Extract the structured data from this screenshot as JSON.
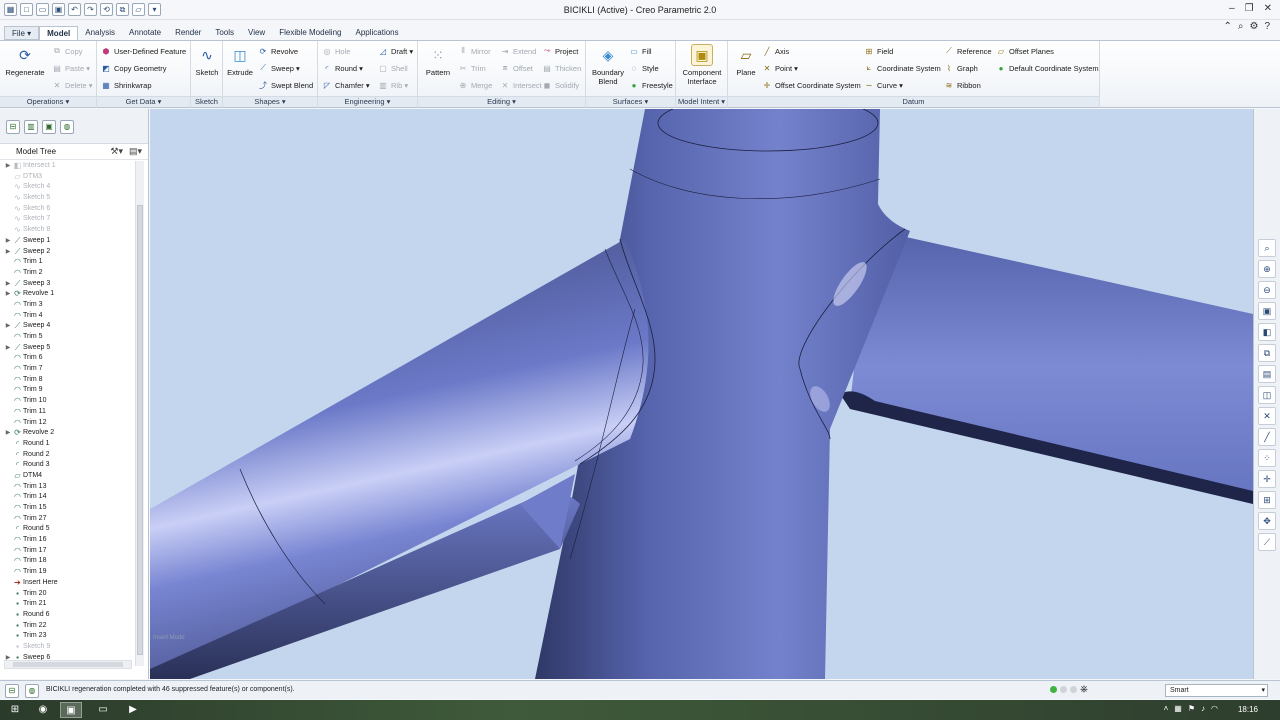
{
  "window": {
    "title": "BICIKLI (Active) - Creo Parametric 2.0"
  },
  "tabs": [
    {
      "label": "File ▾"
    },
    {
      "label": "Model"
    },
    {
      "label": "Analysis"
    },
    {
      "label": "Annotate"
    },
    {
      "label": "Render"
    },
    {
      "label": "Tools"
    },
    {
      "label": "View"
    },
    {
      "label": "Flexible Modeling"
    },
    {
      "label": "Applications"
    }
  ],
  "ribbon": {
    "operations": {
      "label": "Operations ▾",
      "regenerate": "Regenerate",
      "copy": "Copy",
      "paste": "Paste ▾",
      "delete": "Delete ▾"
    },
    "getdata": {
      "label": "Get Data ▾",
      "udf": "User-Defined Feature",
      "copy_geometry": "Copy Geometry",
      "shrinkwrap": "Shrinkwrap"
    },
    "sketch": {
      "label": "Sketch",
      "button": "Sketch"
    },
    "shapes": {
      "label": "Shapes ▾",
      "extrude": "Extrude",
      "revolve": "Revolve",
      "sweep": "Sweep ▾",
      "swept_blend": "Swept Blend"
    },
    "engineering": {
      "label": "Engineering ▾",
      "hole": "Hole",
      "round": "Round ▾",
      "chamfer": "Chamfer ▾",
      "draft": "Draft ▾",
      "shell": "Shell",
      "rib": "Rib ▾"
    },
    "editing": {
      "label": "Editing ▾",
      "pattern": "Pattern",
      "mirror": "Mirror",
      "trim": "Trim",
      "merge": "Merge",
      "extend": "Extend",
      "offset": "Offset",
      "intersect": "Intersect",
      "project": "Project",
      "thicken": "Thicken",
      "solidify": "Solidify"
    },
    "surfaces": {
      "label": "Surfaces ▾",
      "boundary_blend": "Boundary Blend",
      "fill": "Fill",
      "style": "Style",
      "freestyle": "Freestyle"
    },
    "modelintent": {
      "label": "Model Intent ▾",
      "component_interface": "Component Interface"
    },
    "datum": {
      "label": "Datum",
      "plane": "Plane",
      "axis": "Axis",
      "point": "Point ▾",
      "offset_csys": "Offset Coordinate System",
      "field": "Field",
      "coordinate_system": "Coordinate System",
      "curve": "Curve ▾",
      "reference": "Reference",
      "graph": "Graph",
      "ribbon": "Ribbon",
      "offset_planes": "Offset Planes",
      "default_csys": "Default Coordinate System"
    }
  },
  "model_tree": {
    "title": "Model Tree",
    "items": [
      {
        "label": "Intersect 1",
        "expand": "▶",
        "icon": "◧",
        "sup": true
      },
      {
        "label": "DTM3",
        "expand": "",
        "icon": "▱",
        "sup": true
      },
      {
        "label": "Sketch 4",
        "expand": "",
        "icon": "∿",
        "sup": true
      },
      {
        "label": "Sketch 5",
        "expand": "",
        "icon": "∿",
        "sup": true
      },
      {
        "label": "Sketch 6",
        "expand": "",
        "icon": "∿",
        "sup": true
      },
      {
        "label": "Sketch 7",
        "expand": "",
        "icon": "∿",
        "sup": true
      },
      {
        "label": "Sketch 8",
        "expand": "",
        "icon": "∿",
        "sup": true
      },
      {
        "label": "Sweep 1",
        "expand": "▶",
        "icon": "⟋",
        "sup": false
      },
      {
        "label": "Sweep 2",
        "expand": "▶",
        "icon": "⟋",
        "sup": false
      },
      {
        "label": "Trim 1",
        "expand": "",
        "icon": "◠",
        "sup": false
      },
      {
        "label": "Trim 2",
        "expand": "",
        "icon": "◠",
        "sup": false
      },
      {
        "label": "Sweep 3",
        "expand": "▶",
        "icon": "⟋",
        "sup": false
      },
      {
        "label": "Revolve 1",
        "expand": "▶",
        "icon": "⟳",
        "sup": false
      },
      {
        "label": "Trim 3",
        "expand": "",
        "icon": "◠",
        "sup": false
      },
      {
        "label": "Trim 4",
        "expand": "",
        "icon": "◠",
        "sup": false
      },
      {
        "label": "Sweep 4",
        "expand": "▶",
        "icon": "⟋",
        "sup": false
      },
      {
        "label": "Trim 5",
        "expand": "",
        "icon": "◠",
        "sup": false
      },
      {
        "label": "Sweep 5",
        "expand": "▶",
        "icon": "⟋",
        "sup": false
      },
      {
        "label": "Trim 6",
        "expand": "",
        "icon": "◠",
        "sup": false
      },
      {
        "label": "Trim 7",
        "expand": "",
        "icon": "◠",
        "sup": false
      },
      {
        "label": "Trim 8",
        "expand": "",
        "icon": "◠",
        "sup": false
      },
      {
        "label": "Trim 9",
        "expand": "",
        "icon": "◠",
        "sup": false
      },
      {
        "label": "Trim 10",
        "expand": "",
        "icon": "◠",
        "sup": false
      },
      {
        "label": "Trim 11",
        "expand": "",
        "icon": "◠",
        "sup": false
      },
      {
        "label": "Trim 12",
        "expand": "",
        "icon": "◠",
        "sup": false
      },
      {
        "label": "Revolve 2",
        "expand": "▶",
        "icon": "⟳",
        "sup": false
      },
      {
        "label": "Round 1",
        "expand": "",
        "icon": "◜",
        "sup": false
      },
      {
        "label": "Round 2",
        "expand": "",
        "icon": "◜",
        "sup": false
      },
      {
        "label": "Round 3",
        "expand": "",
        "icon": "◜",
        "sup": false
      },
      {
        "label": "DTM4",
        "expand": "",
        "icon": "▱",
        "sup": false
      },
      {
        "label": "Trim 13",
        "expand": "",
        "icon": "◠",
        "sup": false
      },
      {
        "label": "Trim 14",
        "expand": "",
        "icon": "◠",
        "sup": false
      },
      {
        "label": "Trim 15",
        "expand": "",
        "icon": "◠",
        "sup": false
      },
      {
        "label": "Trim 27",
        "expand": "",
        "icon": "◠",
        "sup": false
      },
      {
        "label": "Round 5",
        "expand": "",
        "icon": "◜",
        "sup": false
      },
      {
        "label": "Trim 16",
        "expand": "",
        "icon": "◠",
        "sup": false
      },
      {
        "label": "Trim 17",
        "expand": "",
        "icon": "◠",
        "sup": false
      },
      {
        "label": "Trim 18",
        "expand": "",
        "icon": "◠",
        "sup": false
      },
      {
        "label": "Trim 19",
        "expand": "",
        "icon": "◠",
        "sup": false
      },
      {
        "label": "Insert Here",
        "expand": "",
        "icon": "➔",
        "sup": false,
        "insert": true
      },
      {
        "label": "Trim 20",
        "expand": "",
        "icon": "▪",
        "sup": false
      },
      {
        "label": "Trim 21",
        "expand": "",
        "icon": "▪",
        "sup": false
      },
      {
        "label": "Round 6",
        "expand": "",
        "icon": "▪",
        "sup": false
      },
      {
        "label": "Trim 22",
        "expand": "",
        "icon": "▪",
        "sup": false
      },
      {
        "label": "Trim 23",
        "expand": "",
        "icon": "▪",
        "sup": false
      },
      {
        "label": "Sketch 9",
        "expand": "",
        "icon": "▪",
        "sup": true
      },
      {
        "label": "Sweep 6",
        "expand": "▶",
        "icon": "▪",
        "sup": false
      }
    ]
  },
  "viewport": {
    "watermark": "Insert Mode"
  },
  "status": {
    "message": "BICIKLI regeneration completed with 46 suppressed feature(s) or component(s).",
    "filter": "Smart"
  },
  "taskbar": {
    "time": "18:16"
  },
  "colors": {
    "accent": "#2a5da8",
    "model": "#6f7fcf",
    "background": "#c4d6ee"
  }
}
